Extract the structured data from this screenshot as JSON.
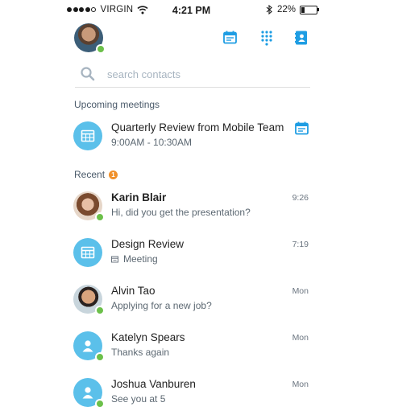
{
  "status_bar": {
    "carrier": "VIRGIN",
    "time": "4:21 PM",
    "battery": "22%"
  },
  "search": {
    "placeholder": "search contacts"
  },
  "upcoming": {
    "heading": "Upcoming meetings",
    "items": [
      {
        "title": "Quarterly Review from Mobile Team",
        "time_range": "9:00AM - 10:30AM",
        "icon": "calendar-icon"
      }
    ]
  },
  "recent": {
    "heading": "Recent",
    "badge": "1",
    "items": [
      {
        "name": "Karin Blair",
        "message": "Hi, did you get the presentation?",
        "time": "9:26",
        "unread": true,
        "avatar": "photo"
      },
      {
        "name": "Design Review",
        "message": "Meeting",
        "time": "7:19",
        "avatar": "calendar-icon"
      },
      {
        "name": "Alvin Tao",
        "message": "Applying for a new job?",
        "time": "Mon",
        "avatar": "photo"
      },
      {
        "name": "Katelyn Spears",
        "message": "Thanks again",
        "time": "Mon",
        "avatar": "person-icon"
      },
      {
        "name": "Joshua Vanburen",
        "message": "See you at 5",
        "time": "Mon",
        "avatar": "person-icon"
      }
    ]
  },
  "colors": {
    "accent": "#1e9de3",
    "avatar_blue": "#5bc0ea",
    "presence_online": "#6cc04a",
    "badge_orange": "#f0902a"
  }
}
